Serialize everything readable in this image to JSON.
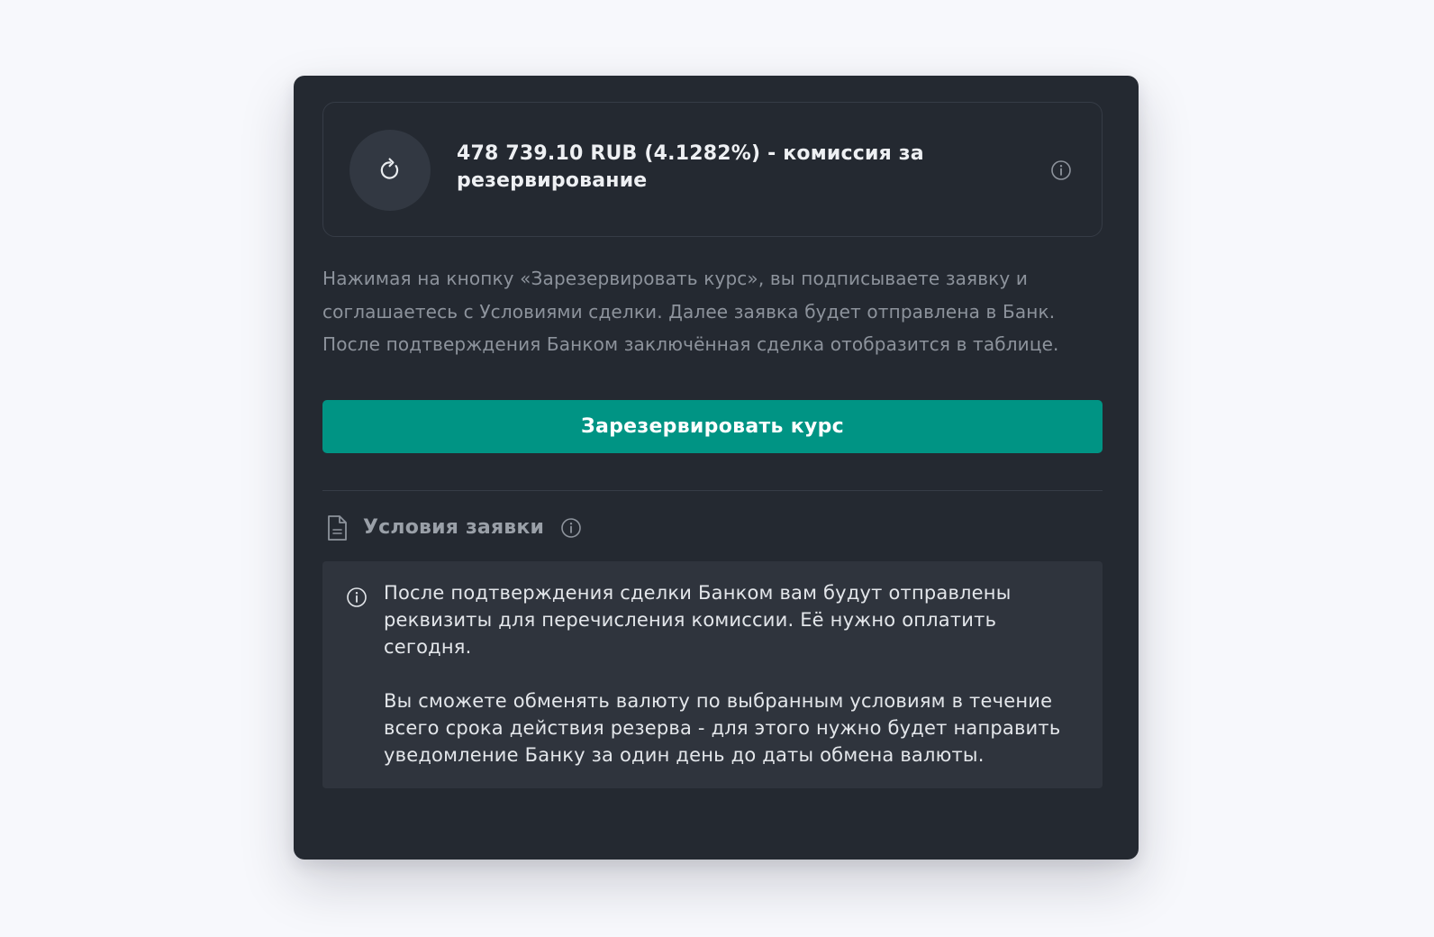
{
  "fee": {
    "icon": "refresh-icon",
    "text": "478 739.10 RUB (4.1282%) - комиссия за резервирование",
    "info_icon": "info-icon"
  },
  "disclaimer": "Нажимая на кнопку «Зарезервировать курс», вы подписываете заявку и соглашаетесь с Условиями сделки. Далее заявка будет отправлена в Банк. После подтверждения Банком заключённая сделка отобразится в таблице.",
  "reserve_button": {
    "label": "Зарезервировать курс",
    "color": "#009484"
  },
  "conditions": {
    "icon": "document-icon",
    "title": "Условия заявки",
    "info_icon": "info-icon",
    "notice": {
      "icon": "info-icon",
      "paragraph_1": "После подтверждения сделки Банком вам будут отправлены реквизиты для перечисления комиссии. Её нужно оплатить сегодня.",
      "paragraph_2": "Вы сможете обменять валюту по выбранным условиям в течение всего срока действия резерва - для этого нужно будет направить уведомление Банку за один день до даты обмена валюты."
    }
  },
  "colors": {
    "card_background": "#242931",
    "page_background": "#f7f8fc",
    "accent": "#009484"
  }
}
